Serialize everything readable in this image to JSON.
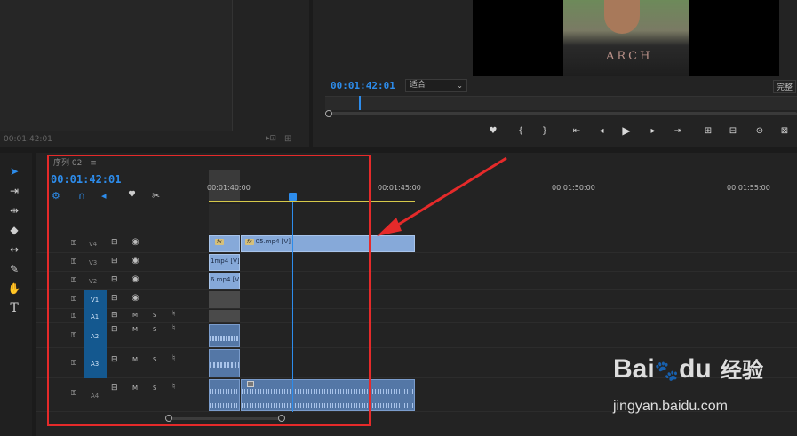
{
  "source_monitor": {
    "timecode": "00:01:42:01"
  },
  "program_monitor": {
    "timecode": "00:01:42:01",
    "fit_select": "适合",
    "quality": "完整",
    "photo_text": "ARCH"
  },
  "controls": [
    "♥",
    "{",
    "}",
    "⇤",
    "◂",
    "▶",
    "▸",
    "⇥",
    "⊞",
    "⊟",
    "⊙",
    "⊠"
  ],
  "timeline": {
    "sequence_name": "序列 02",
    "timecode": "00:01:42:01",
    "ruler": [
      "00:01:40:00",
      "00:01:45:00",
      "00:01:50:00",
      "00:01:55:00"
    ],
    "tracks": [
      {
        "name": "V4",
        "lock": "🔒",
        "sync": "⊟",
        "vis": "👁"
      },
      {
        "name": "V3",
        "lock": "🔒",
        "sync": "⊟",
        "vis": "👁"
      },
      {
        "name": "V2",
        "lock": "🔒",
        "sync": "⊟",
        "vis": "👁"
      },
      {
        "name": "V1",
        "lock": "🔒",
        "sync": "⊟",
        "vis": "👁"
      },
      {
        "name": "A1",
        "lock": "🔒",
        "m": "M",
        "s": "S",
        "mic": "🎙"
      },
      {
        "name": "A2",
        "lock": "🔒",
        "m": "M",
        "s": "S",
        "mic": "🎙"
      },
      {
        "name": "A3",
        "lock": "🔒",
        "m": "M",
        "s": "S",
        "mic": "🎙"
      },
      {
        "name": "A4",
        "lock": "🔒",
        "m": "M",
        "s": "S",
        "mic": "🎙"
      }
    ],
    "clips": {
      "v4_main": "05.mp4 [V]",
      "v3": "1mp4 [V]",
      "v2": "6.mp4 [V]"
    }
  },
  "watermark": {
    "brand": "Bai",
    "brand2": "du",
    "cn": "经验",
    "url": "jingyan.baidu.com"
  },
  "colors": {
    "accent": "#2d8ceb",
    "highlight": "#e52a2a",
    "clip": "#86a9d9"
  }
}
